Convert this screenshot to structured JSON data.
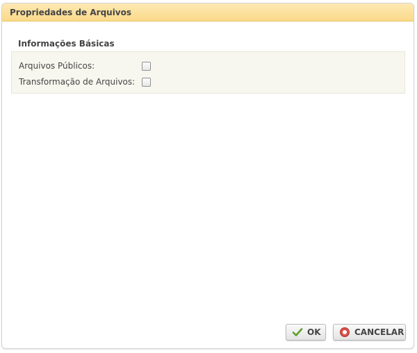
{
  "dialog": {
    "title": "Propriedades de Arquivos"
  },
  "section": {
    "title": "Informações Básicas"
  },
  "fields": [
    {
      "label": "Arquivos Públicos:",
      "checked": false
    },
    {
      "label": "Transformação de Arquivos:",
      "checked": false
    }
  ],
  "buttons": {
    "ok_label": "OK",
    "ok_icon": "checkmark-icon",
    "cancel_label": "CANCELAR",
    "cancel_icon": "cancel-circle-icon"
  },
  "colors": {
    "titlebar": "#fad98a",
    "ok_icon": "#5aa02c",
    "cancel_icon": "#d9534f"
  }
}
